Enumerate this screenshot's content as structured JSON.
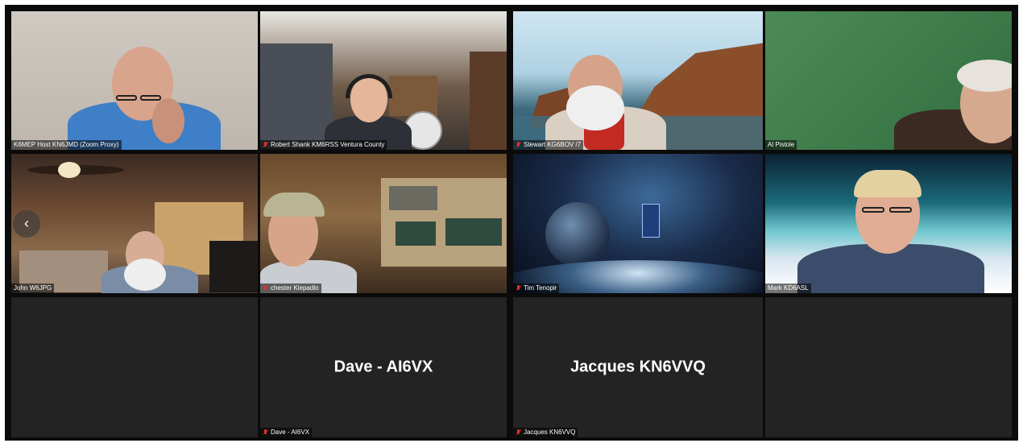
{
  "meeting": {
    "participants": [
      {
        "name": "K6MEP Host KN6JMD (Zoom Proxy)",
        "muted": false,
        "video": true
      },
      {
        "name": "Robert Shank KM6RSS Ventura County",
        "muted": true,
        "video": true
      },
      {
        "name": "Stewart KG6BOV /7",
        "muted": true,
        "video": true
      },
      {
        "name": "Al Pistole",
        "muted": false,
        "video": true
      },
      {
        "name": "John W6JPG",
        "muted": false,
        "video": true
      },
      {
        "name": "chester Klepadlo",
        "muted": true,
        "video": true
      },
      {
        "name": "Tim Tenopir",
        "muted": true,
        "video": true
      },
      {
        "name": "Mark KD6ASL",
        "muted": false,
        "video": true,
        "active_speaker": true
      },
      {
        "name": "Dave - AI6VX",
        "muted": true,
        "video": false,
        "display_name": "Dave - AI6VX"
      },
      {
        "name": "Jacques KN6VVQ",
        "muted": true,
        "video": false,
        "display_name": "Jacques KN6VVQ"
      }
    ],
    "nav": {
      "prev_icon": "‹"
    }
  },
  "colors": {
    "background": "#0b0b0b",
    "tile_empty": "#232323",
    "active_speaker_border": "#c8e06a",
    "muted_icon": "#e0302a"
  }
}
